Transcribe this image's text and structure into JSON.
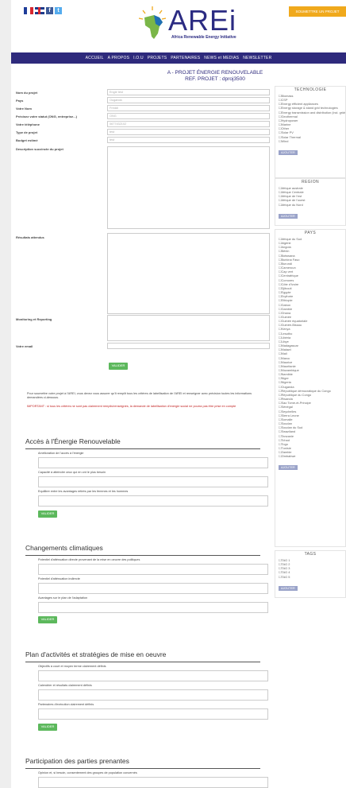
{
  "header": {
    "logo_text": "AREi",
    "logo_sub": "Africa Renewable Energy Initiative",
    "cta_label": "SOUMETTRE UN PROJET"
  },
  "nav": [
    "ACCUEIL",
    "A PROPOS",
    "I.O.U",
    "PROJETS",
    "PARTENAIRES",
    "NEWS et MEDIAS",
    "NEWSLETTER"
  ],
  "title": {
    "line1": "A - PROJET ÉNERGIE RENOUVELABLE",
    "line2": "REF. PROJET : dproj3500"
  },
  "form": {
    "labels": {
      "nom": "Nom du projet",
      "pays": "Pays",
      "votre_nom": "Votre Nom",
      "statut": "Précisez votre statut (ONG, entreprise...)",
      "tel": "Votre téléphone",
      "type": "Type de projet",
      "budget": "Budget estimé",
      "description": "Description succincte du projet",
      "resultats": "Résultats attendus",
      "monitoring": "Monitoring et Reporting",
      "email": "Votre email"
    },
    "values": {
      "nom": "Engie test",
      "pays": "Ouganda",
      "votre_nom": "Freddi",
      "statut": "ONG",
      "tel": "0677432102",
      "type": "test",
      "budget": "test"
    },
    "submit_label": "VALIDER",
    "note": "Pour soumettre votre projet à l'AREI, vous devez vous assurer qu'il remplit tous les critères de labellisation de l'AREI et renseigner avec précision toutes les informations demandées ci-dessous.",
    "note_red": "IMPORTANT : si tous les critères ne sont pas clairement remplis/renseignés, la demande de labellisation d'energie social ne pourra pas être prise en compte"
  },
  "sections": [
    {
      "title": "Accès à l'Énergie Renouvelable",
      "questions": [
        "Amélioration de l'accès à l'énergie",
        "Capacité à atteindre ceux qui en ont le plus besoin",
        "Equilibre entre les avantages retirés par les femmes et les hommes"
      ],
      "button": "VALIDER"
    },
    {
      "title": "Changements climatiques",
      "questions": [
        "Potentiel d'atténuation directe provenant de la mise en oeuvre des politiques",
        "Potentiel d'atténuation indirecte",
        "Avantages sur le plan de l'adaptation"
      ],
      "button": "VALIDER"
    },
    {
      "title": "Plan d'activités et stratégies de mise en oeuvre",
      "questions": [
        "Objectifs à court et moyen terme clairement définis",
        "Calendrier et résultats clairement définis",
        "Partenaires d'exécution clairement définis"
      ],
      "button": "VALIDER"
    },
    {
      "title": "Participation des parties prenantes",
      "questions": [
        "Opinion et, si besoin, consentement des groupes de population concernés"
      ],
      "button": ""
    }
  ],
  "sidebar": {
    "technologie": {
      "title": "TECHNOLOGIE",
      "items": [
        "Biomass",
        "CSP",
        "Energy efficient appliances",
        "Energy storage & stand grid technologies",
        "Energy transmission and distribution (incl. grids and mini-grids)",
        "Geothermal",
        "Hydropower",
        "Marine",
        "Other",
        "Solar PV",
        "Solar Thermal",
        "Wind"
      ],
      "button": "AJOUTER"
    },
    "region": {
      "title": "REGION",
      "items": [
        "Afrique australe",
        "Afrique Centrale",
        "Afrique de l'est",
        "Afrique de l'ouest",
        "Afrique du Nord"
      ],
      "button": "AJOUTER"
    },
    "pays": {
      "title": "PAYS",
      "items": [
        "Afrique du Sud",
        "Algérie",
        "Angola",
        "Bénin",
        "Botswana",
        "Burkina Faso",
        "Burundi",
        "Cameroun",
        "Cap vert",
        "Centrafrique",
        "Comores",
        "Côte d'Ivoire",
        "Djibouti",
        "Egypte",
        "Erythrée",
        "Ethiopie",
        "Gabon",
        "Gambie",
        "Ghana",
        "Guinée",
        "Guinée équatoriale",
        "Guinée-Bissau",
        "Kenya",
        "Lesotho",
        "Libéria",
        "Libye",
        "Madagascar",
        "Malawi",
        "Mali",
        "Maroc",
        "Maurice",
        "Mauritanie",
        "Mozambique",
        "Namibie",
        "Niger",
        "Nigeria",
        "Ouganda",
        "République démocratique du Congo",
        "République du Congo",
        "Rwanda",
        "Sao Tomé-et-Principe",
        "Sénégal",
        "Seychelles",
        "Sierra Leone",
        "Somalie",
        "Soudan",
        "Soudan du Sud",
        "Swaziland",
        "Tanzanie",
        "Tchad",
        "Togo",
        "Tunisie",
        "Zambie",
        "Zimbabwe"
      ],
      "button": "AJOUTER"
    },
    "tags": {
      "title": "TAGS",
      "items": [
        "TAG 1",
        "TAG 2",
        "TAG 3",
        "TAG 4",
        "TAG 5"
      ],
      "button": "AJOUTER"
    }
  }
}
